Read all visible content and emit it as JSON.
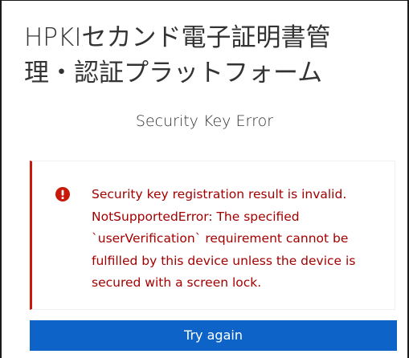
{
  "header": {
    "title_line1": "HPKIセカンド電子証明書管",
    "title_line2": "理・認証プラットフォーム"
  },
  "page": {
    "subtitle": "Security Key Error"
  },
  "alert": {
    "icon": "exclamation-circle-icon",
    "lines": [
      "Security key registration result is invalid.",
      "NotSupportedError: The specified",
      "`userVerification` requirement cannot be",
      "fulfilled by this device unless the device is",
      "secured with a screen lock."
    ]
  },
  "actions": {
    "try_again_label": "Try again"
  },
  "colors": {
    "danger": "#c9190b",
    "danger_text": "#a30000",
    "primary": "#0d63c7",
    "text": "#333333"
  }
}
